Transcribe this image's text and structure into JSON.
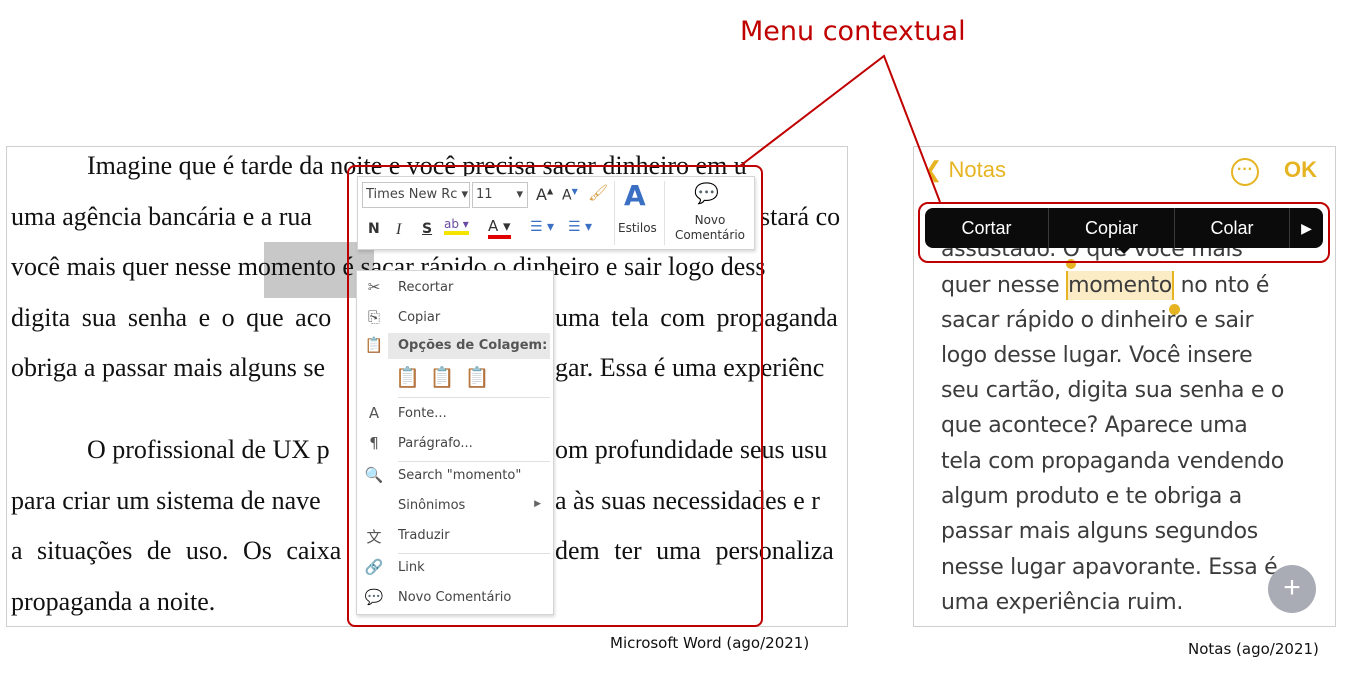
{
  "annotation": {
    "title": "Menu contextual",
    "accent": "#c00000"
  },
  "word": {
    "caption": "Microsoft Word (ago/2021)",
    "selected_word": "momento",
    "lines": [
      {
        "left": "Imagine que é tarde da noite e você precisa sacar dinheiro em u",
        "right": ""
      },
      {
        "left": "uma agência bancária e a rua",
        "right": "stará co"
      },
      {
        "left": "você mais quer nesse momento é sacar rápido o dinheiro e sair logo dess",
        "right": ""
      },
      {
        "left": "digita sua senha e o que aco",
        "right": "uma tela com propaganda"
      },
      {
        "left": "obriga a passar mais alguns se",
        "right": "gar. Essa é uma experiênc"
      },
      {
        "left": "O profissional de UX p",
        "right": "om profundidade seus usu"
      },
      {
        "left": "para criar um sistema de nave",
        "right": "a às suas necessidades e r"
      },
      {
        "left": "a situações de uso. Os caixa",
        "right": "dem ter uma personaliza"
      },
      {
        "left": "propaganda a noite.",
        "right": ""
      }
    ],
    "mini_toolbar": {
      "font": "Times New Rc",
      "size": "11",
      "bold": "N",
      "italic": "I",
      "strike": "S",
      "styles": "Estilos",
      "new_comment": "Novo Comentário"
    },
    "context_menu": {
      "cut": "Recortar",
      "copy": "Copiar",
      "paste_options": "Opções de Colagem:",
      "font": "Fonte...",
      "paragraph": "Parágrafo...",
      "search": "Search \"momento\"",
      "synonyms": "Sinônimos",
      "translate": "Traduzir",
      "link": "Link",
      "new_comment": "Novo Comentário"
    }
  },
  "notes": {
    "caption": "Notas (ago/2021)",
    "back": "Notas",
    "done": "OK",
    "accent": "#e6b422",
    "menu": [
      "Cortar",
      "Copiar",
      "Colar"
    ],
    "selected_word": "momento",
    "lines": [
      "assustado. O que você mais",
      "quer nesse |momento| no nto é",
      "sacar rápido o dinheiro e sair",
      "logo desse lugar. Você insere",
      "seu cartão, digita sua senha e o",
      "que acontece? Aparece uma",
      "tela com propaganda vendendo",
      "algum produto e te obriga a",
      "passar mais alguns segundos",
      "nesse lugar apavorante. Essa é",
      "uma experiência ruim."
    ],
    "line1_pre": "quer nesse ",
    "line1_post": " no nto é"
  }
}
